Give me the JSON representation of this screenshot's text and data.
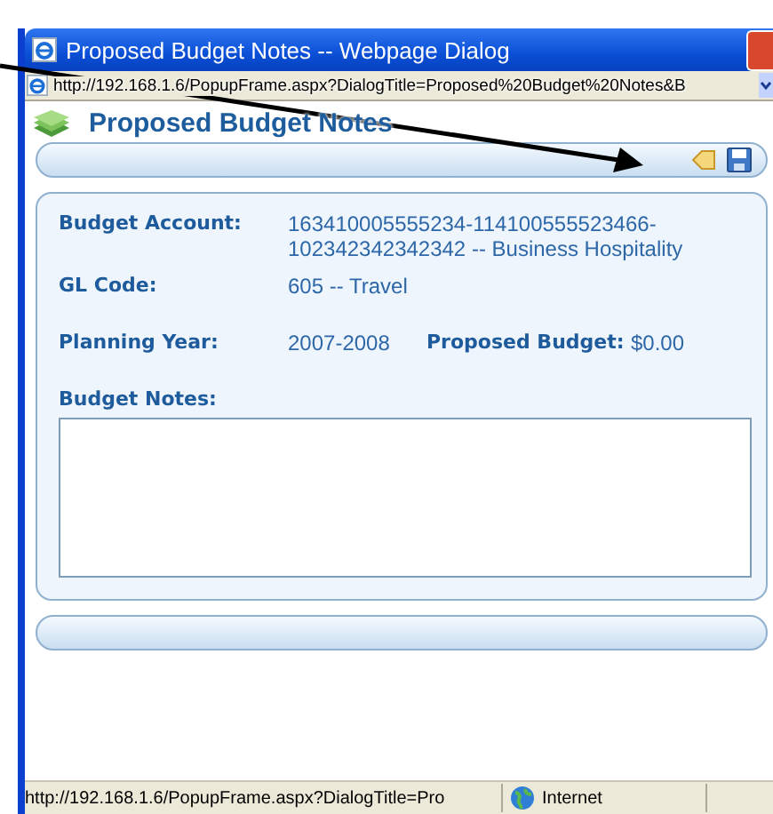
{
  "window": {
    "title": "Proposed Budget Notes -- Webpage Dialog"
  },
  "address_bar": {
    "url": "http://192.168.1.6/PopupFrame.aspx?DialogTitle=Proposed%20Budget%20Notes&B"
  },
  "page": {
    "heading": "Proposed Budget Notes"
  },
  "fields": [
    {
      "label": "Budget Account:",
      "value": "163410005555234-114100555523466-102342342342342 -- Business Hospitality"
    },
    {
      "label": "GL Code:",
      "value": "605 -- Travel"
    }
  ],
  "planning": {
    "label": "Planning Year:",
    "value": "2007-2008",
    "budget_label": "Proposed Budget:",
    "budget_value": "$0.00"
  },
  "notes": {
    "label": "Budget Notes:"
  },
  "status_bar": {
    "url": "http://192.168.1.6/PopupFrame.aspx?DialogTitle=Pro",
    "zone": "Internet"
  }
}
